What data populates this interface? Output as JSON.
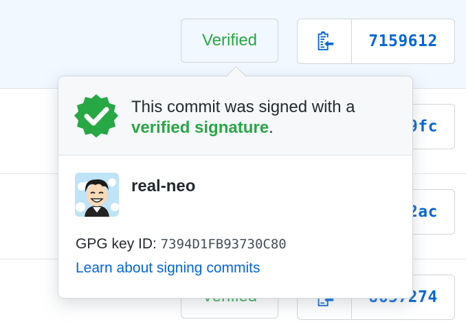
{
  "rows": [
    {
      "badge": "Verified",
      "sha": "7159612"
    },
    {
      "sha": "9fc"
    },
    {
      "sha": "2ac"
    },
    {
      "badge": "Verified",
      "sha": "8657274"
    }
  ],
  "popover": {
    "message_prefix": "This commit was signed with a",
    "message_strong": "verified signature",
    "message_suffix": ".",
    "username": "real-neo",
    "gpg_label": "GPG key ID:",
    "gpg_key": "7394D1FB93730C80",
    "learn_link": "Learn about signing commits"
  },
  "icons": {
    "copy": "clipboard-copy-icon",
    "verified": "verified-badge-icon"
  },
  "colors": {
    "verified_green": "#28a745",
    "link_blue": "#0366d6",
    "row_highlight": "#f1f8ff"
  }
}
